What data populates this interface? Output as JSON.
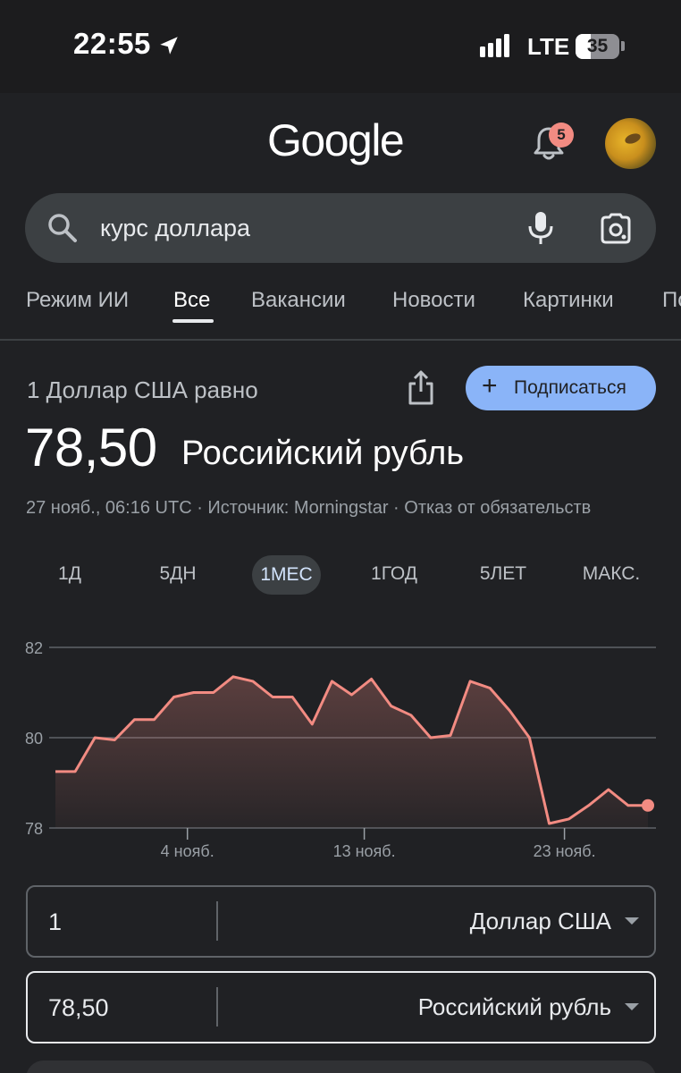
{
  "status_bar": {
    "time": "22:55",
    "network": "LTE",
    "battery_level": "35",
    "battery_fraction": 0.35
  },
  "header": {
    "logo_text": "Google",
    "notification_count": "5"
  },
  "search": {
    "query": "курс доллара"
  },
  "tabs": [
    {
      "label": "Режим ИИ",
      "active": false
    },
    {
      "label": "Все",
      "active": true
    },
    {
      "label": "Вакансии",
      "active": false
    },
    {
      "label": "Новости",
      "active": false
    },
    {
      "label": "Картинки",
      "active": false
    },
    {
      "label": "По",
      "active": false
    }
  ],
  "currency": {
    "equals_label": "1 Доллар США равно",
    "subscribe_label": "Подписаться",
    "value": "78,50",
    "target_currency": "Российский рубль",
    "meta": "27 нояб., 06:16 UTC · Источник: Morningstar · Отказ от обязательств"
  },
  "ranges": [
    {
      "label": "1Д",
      "active": false
    },
    {
      "label": "5ДН",
      "active": false
    },
    {
      "label": "1МЕС",
      "active": true
    },
    {
      "label": "1ГОД",
      "active": false
    },
    {
      "label": "5ЛЕТ",
      "active": false
    },
    {
      "label": "МАКС.",
      "active": false
    }
  ],
  "chart_data": {
    "type": "area",
    "title": "",
    "xlabel": "",
    "ylabel": "",
    "ylim": [
      78,
      82
    ],
    "y_ticks": [
      "82",
      "80",
      "78"
    ],
    "x_ticks": [
      "4 нояб.",
      "13 нояб.",
      "23 нояб."
    ],
    "grid": true,
    "line_color": "#f28b82",
    "series": [
      {
        "values": [
          79.25,
          79.25,
          80.0,
          79.95,
          80.4,
          80.4,
          80.9,
          81.0,
          81.0,
          81.35,
          81.25,
          80.9,
          80.9,
          80.3,
          81.25,
          80.95,
          81.3,
          80.7,
          80.5,
          80.0,
          80.05,
          81.25,
          81.1,
          80.6,
          80.0,
          78.1,
          78.2,
          78.5,
          78.85,
          78.5,
          78.5
        ]
      }
    ]
  },
  "converter": {
    "from_amount": "1",
    "from_currency": "Доллар США",
    "to_amount": "78,50",
    "to_currency": "Российский рубль"
  }
}
